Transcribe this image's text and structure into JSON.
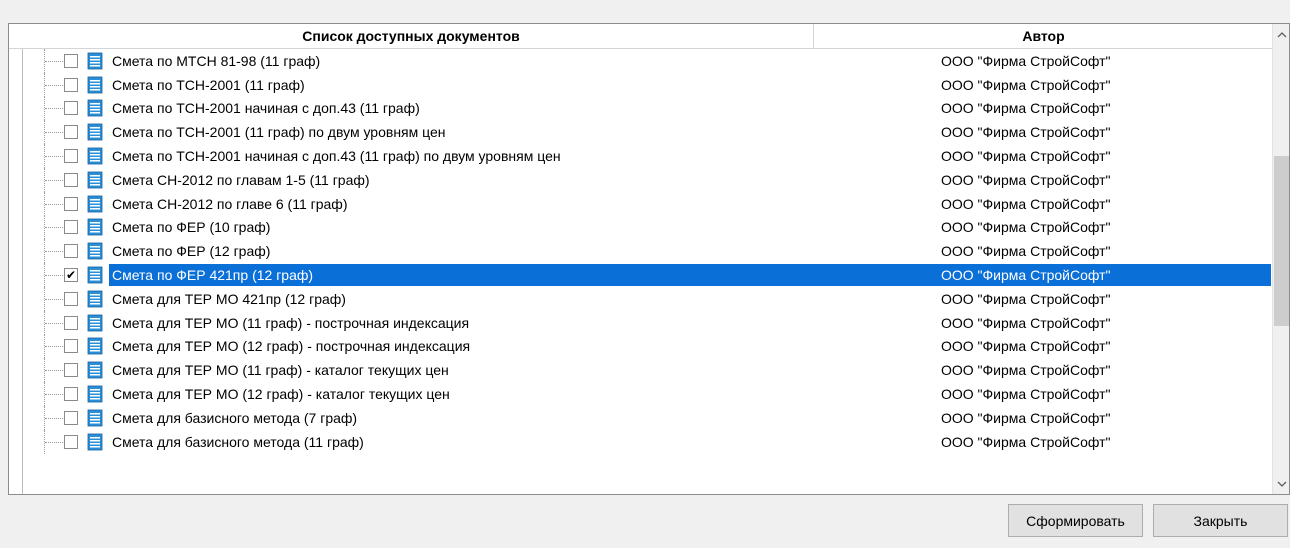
{
  "table": {
    "columns": {
      "name": "Список доступных документов",
      "author": "Автор"
    },
    "rows": [
      {
        "name": "Смета по МТСН 81-98 (11 граф)",
        "author": "ООО \"Фирма СтройСофт\"",
        "checked": false,
        "selected": false
      },
      {
        "name": "Смета по ТСН-2001 (11 граф)",
        "author": "ООО \"Фирма СтройСофт\"",
        "checked": false,
        "selected": false
      },
      {
        "name": "Смета по ТСН-2001 начиная с доп.43 (11 граф)",
        "author": "ООО \"Фирма СтройСофт\"",
        "checked": false,
        "selected": false
      },
      {
        "name": "Смета по ТСН-2001 (11 граф) по двум уровням цен",
        "author": "ООО \"Фирма СтройСофт\"",
        "checked": false,
        "selected": false
      },
      {
        "name": "Смета по ТСН-2001 начиная с доп.43 (11 граф) по двум уровням цен",
        "author": "ООО \"Фирма СтройСофт\"",
        "checked": false,
        "selected": false
      },
      {
        "name": "Смета СН-2012 по главам 1-5 (11 граф)",
        "author": "ООО \"Фирма СтройСофт\"",
        "checked": false,
        "selected": false
      },
      {
        "name": "Смета СН-2012 по главе 6 (11 граф)",
        "author": "ООО \"Фирма СтройСофт\"",
        "checked": false,
        "selected": false
      },
      {
        "name": "Смета по ФЕР  (10 граф)",
        "author": "ООО \"Фирма СтройСофт\"",
        "checked": false,
        "selected": false
      },
      {
        "name": "Смета по ФЕР (12 граф)",
        "author": "ООО \"Фирма СтройСофт\"",
        "checked": false,
        "selected": false
      },
      {
        "name": "Смета по ФЕР 421пр (12 граф)",
        "author": "ООО \"Фирма СтройСофт\"",
        "checked": true,
        "selected": true
      },
      {
        "name": "Смета для ТЕР МО 421пр (12 граф)",
        "author": "ООО \"Фирма СтройСофт\"",
        "checked": false,
        "selected": false
      },
      {
        "name": "Смета для ТЕР МО  (11 граф) - построчная индексация",
        "author": "ООО \"Фирма СтройСофт\"",
        "checked": false,
        "selected": false
      },
      {
        "name": "Смета для ТЕР МО  (12 граф) - построчная индексация",
        "author": "ООО \"Фирма СтройСофт\"",
        "checked": false,
        "selected": false
      },
      {
        "name": "Смета для ТЕР МО  (11 граф) - каталог текущих цен",
        "author": "ООО \"Фирма СтройСофт\"",
        "checked": false,
        "selected": false
      },
      {
        "name": "Смета для ТЕР МО  (12 граф) - каталог текущих цен",
        "author": "ООО \"Фирма СтройСофт\"",
        "checked": false,
        "selected": false
      },
      {
        "name": "Смета для базисного метода  (7 граф)",
        "author": "ООО \"Фирма СтройСофт\"",
        "checked": false,
        "selected": false
      },
      {
        "name": "Смета для базисного метода  (11 граф)",
        "author": "ООО \"Фирма СтройСофт\"",
        "checked": false,
        "selected": false
      }
    ]
  },
  "icons": {
    "row_icon": "document-icon",
    "check_glyph": "✔",
    "scroll_up": "up-arrow-icon",
    "scroll_down": "down-arrow-icon"
  },
  "buttons": {
    "generate": "Сформировать",
    "close": "Закрыть"
  },
  "colors": {
    "selection": "#0a6fd6",
    "doc_icon": "#2a8fd8"
  }
}
